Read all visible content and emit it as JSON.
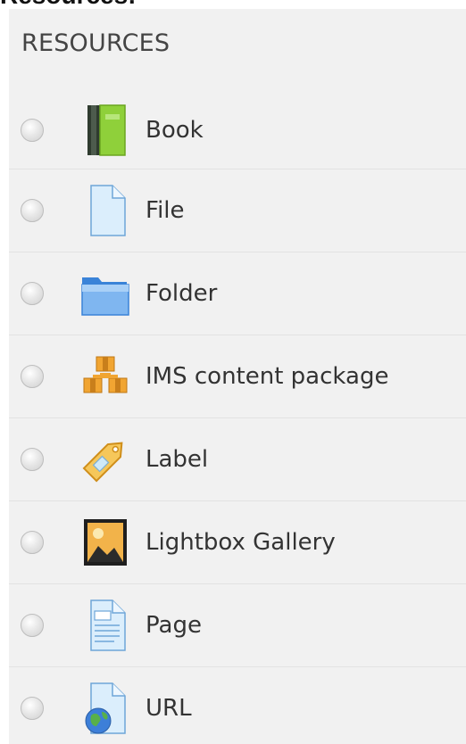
{
  "page": {
    "heading": "Resources:"
  },
  "panel": {
    "title": "RESOURCES"
  },
  "items": [
    {
      "label": "Book",
      "icon": "book-icon"
    },
    {
      "label": "File",
      "icon": "file-icon"
    },
    {
      "label": "Folder",
      "icon": "folder-icon"
    },
    {
      "label": "IMS content package",
      "icon": "ims-content-package-icon"
    },
    {
      "label": "Label",
      "icon": "label-tag-icon"
    },
    {
      "label": "Lightbox Gallery",
      "icon": "gallery-image-icon"
    },
    {
      "label": "Page",
      "icon": "page-icon"
    },
    {
      "label": "URL",
      "icon": "url-globe-icon"
    }
  ]
}
